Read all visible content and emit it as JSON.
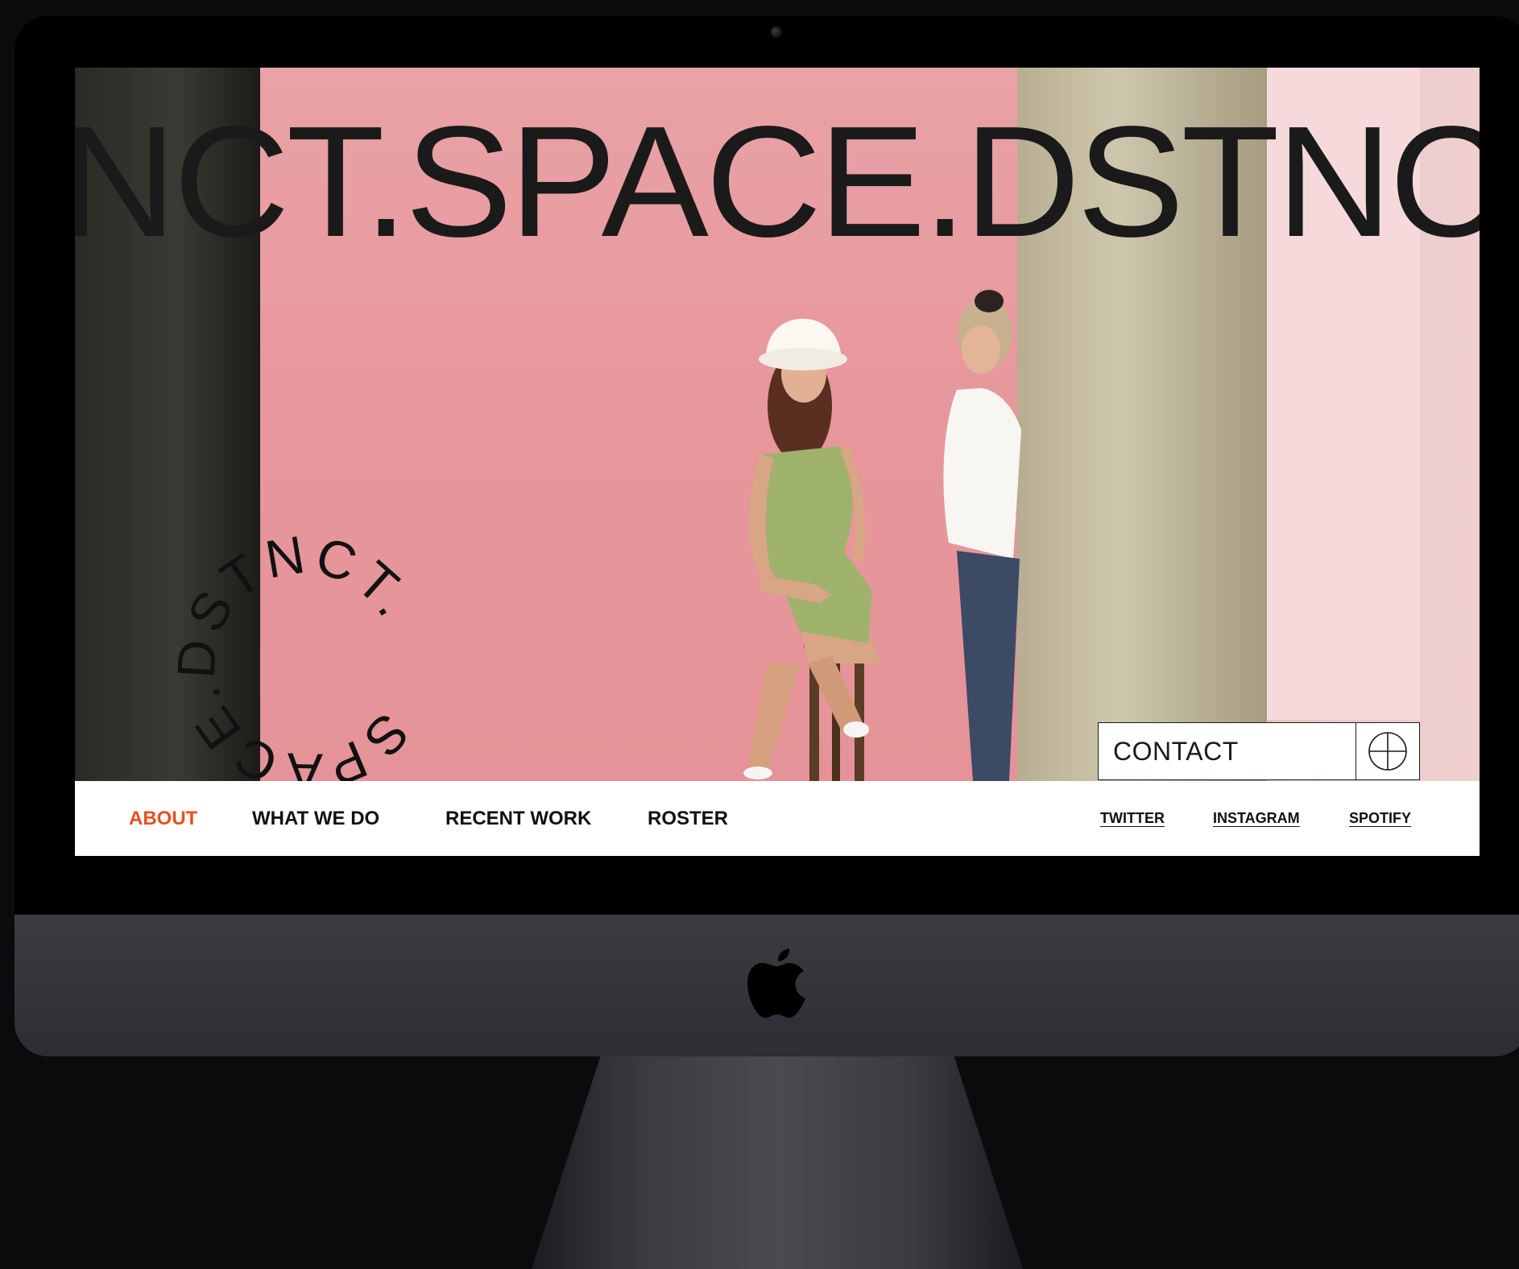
{
  "marquee_text": "NCT.SPACE.DSTNCT.",
  "circular_text": "SPACE.DSTNCT.",
  "contact": {
    "label": "CONTACT",
    "icon": "plus-circle-icon"
  },
  "nav": {
    "items": [
      {
        "label": "ABOUT",
        "active": true
      },
      {
        "label": "WHAT WE DO",
        "active": false
      },
      {
        "label": "RECENT WORK",
        "active": false
      },
      {
        "label": "ROSTER",
        "active": false
      }
    ],
    "social": [
      {
        "label": "TWITTER"
      },
      {
        "label": "INSTAGRAM"
      },
      {
        "label": "SPOTIFY"
      }
    ]
  },
  "colors": {
    "accent": "#e8501e",
    "backdrop": "#e79ea3",
    "text": "#1a1a1a"
  },
  "device": {
    "logo": "apple-logo-icon"
  }
}
